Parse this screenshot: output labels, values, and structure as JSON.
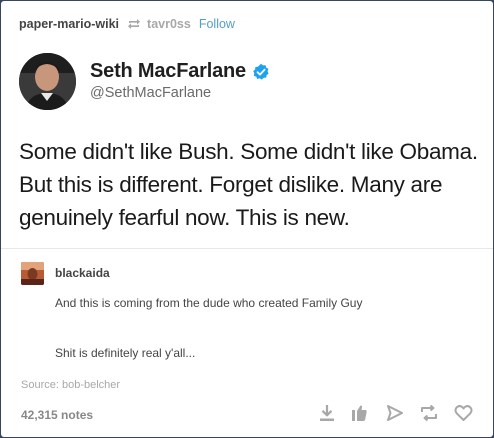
{
  "header": {
    "blog_name": "paper-mario-wiki",
    "reblogged_from": "tavr0ss",
    "follow_label": "Follow"
  },
  "tweet": {
    "author_name": "Seth MacFarlane",
    "author_handle": "@SethMacFarlane",
    "text": "Some didn't like Bush. Some didn't like Obama. But this is different. Forget dislike. Many are genuinely fearful now. This is new."
  },
  "comment": {
    "author": "blackaida",
    "paragraph_1": "And this is coming from the dude who created Family Guy",
    "paragraph_2": "Shit is definitely real y'all..."
  },
  "source": {
    "label": "Source:",
    "value": "bob-belcher"
  },
  "footer": {
    "notes": "42,315 notes"
  },
  "colors": {
    "dashboard_bg": "#36465d",
    "accent": "#529ecc",
    "verified": "#1da1f2",
    "icon_gray": "#a8a8a8"
  }
}
